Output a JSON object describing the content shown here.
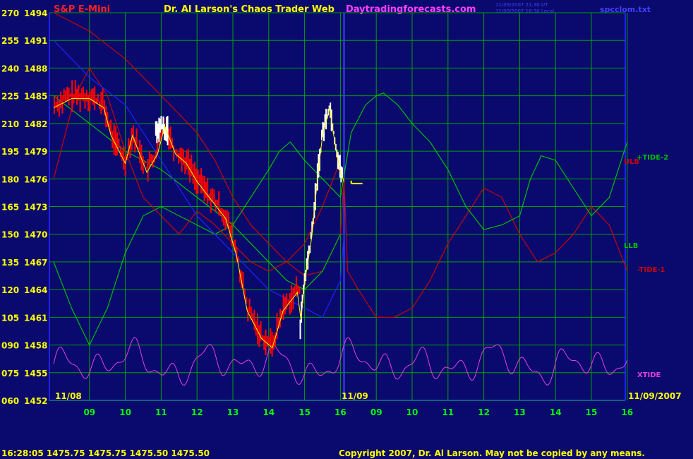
{
  "header": {
    "left_title": "S&P E-Mini",
    "main_title": "Dr. Al Larson's Chaos Trader Web",
    "site": "Daytradingforecasts.com",
    "stamp_line1": "11/09/2007 21:30 UT",
    "stamp_line2": "11/09/2007 16:30 Local",
    "file": "spcclom.txt"
  },
  "footer": {
    "quote": "16:28:05  1475.75 1475.75 1475.50 1475.50",
    "copyright": "Copyright 2007, Dr. Al Larson. May not be copied by any means."
  },
  "date_labels": {
    "left": "11/08",
    "mid": "11/09",
    "right": "11/09/2007"
  },
  "colors": {
    "background": "#0a0a6e",
    "grid": "#00a000",
    "price_bars": "#ff0000",
    "white_bars": "#ffffff",
    "yellow_avg": "#ffff00",
    "tide2": "#00c000",
    "ulb": "#cc0000",
    "llb": "#00c000",
    "tide1": "#cc0000",
    "xtide": "#e040e0",
    "blue_line": "#2020ff",
    "site_text": "#ff40ff",
    "title_text": "#ffff00",
    "left_title_text": "#ff2020",
    "axis_text": "#ffff00",
    "date_text": "#ffff00",
    "hour_text": "#00ff00"
  },
  "chart_data": {
    "type": "line",
    "title": "S&P E-Mini",
    "left_axis_ticks": [
      "270",
      "255",
      "240",
      "225",
      "210",
      "195",
      "180",
      "165",
      "150",
      "135",
      "120",
      "105",
      "090",
      "075",
      "060"
    ],
    "price_axis_ticks": [
      "1494",
      "1491",
      "1488",
      "1485",
      "1482",
      "1479",
      "1476",
      "1473",
      "1470",
      "1467",
      "1464",
      "1461",
      "1458",
      "1455",
      "1452"
    ],
    "ylim": [
      1452,
      1494
    ],
    "x_hour_labels": [
      "09",
      "10",
      "11",
      "12",
      "13",
      "14",
      "15",
      "16",
      "09",
      "10",
      "11",
      "12",
      "13",
      "14",
      "15",
      "16"
    ],
    "last_price": 1475.5,
    "series": [
      {
        "name": "+TIDE-2",
        "label": "+TIDE-2"
      },
      {
        "name": "ULB",
        "label": "ULB"
      },
      {
        "name": "LLB",
        "label": "LLB"
      },
      {
        "name": "-TIDE-1",
        "label": "-TIDE-1"
      },
      {
        "name": "XTIDE",
        "label": "XTIDE"
      }
    ],
    "tide2_points": [
      [
        0,
        1467
      ],
      [
        0.5,
        1462
      ],
      [
        1,
        1458
      ],
      [
        1.5,
        1462
      ],
      [
        2,
        1468
      ],
      [
        2.5,
        1472
      ],
      [
        3,
        1473
      ],
      [
        3.5,
        1472
      ],
      [
        4,
        1471
      ],
      [
        4.5,
        1470
      ],
      [
        5,
        1471
      ],
      [
        5.5,
        1474
      ],
      [
        6,
        1477
      ],
      [
        6.3,
        1479
      ],
      [
        6.6,
        1480
      ],
      [
        7,
        1478
      ],
      [
        7.5,
        1476
      ],
      [
        8,
        1474
      ],
      [
        8.3,
        1481
      ],
      [
        8.7,
        1484
      ],
      [
        9,
        1485
      ],
      [
        9.2,
        1485.3
      ],
      [
        9.6,
        1484
      ],
      [
        10,
        1482
      ],
      [
        10.5,
        1480
      ],
      [
        11,
        1477
      ],
      [
        11.5,
        1473
      ],
      [
        12,
        1470.5
      ],
      [
        12.5,
        1471
      ],
      [
        13,
        1472
      ],
      [
        13.3,
        1476
      ],
      [
        13.6,
        1478.5
      ],
      [
        14,
        1478
      ],
      [
        14.5,
        1475
      ],
      [
        15,
        1472
      ],
      [
        15.5,
        1474
      ],
      [
        16,
        1480
      ]
    ],
    "ulb_points": [
      [
        0,
        1494
      ],
      [
        1,
        1492
      ],
      [
        2,
        1489
      ],
      [
        3,
        1485
      ],
      [
        4,
        1481
      ],
      [
        4.5,
        1478
      ],
      [
        5,
        1474
      ],
      [
        5.5,
        1471
      ],
      [
        6,
        1469
      ],
      [
        6.5,
        1467
      ],
      [
        7,
        1465.5
      ],
      [
        7.5,
        1466
      ],
      [
        8,
        1470
      ],
      [
        8.1,
        1476
      ],
      [
        8.2,
        1466
      ],
      [
        8.5,
        1464
      ],
      [
        9,
        1461
      ],
      [
        9.5,
        1461
      ],
      [
        10,
        1462
      ],
      [
        10.5,
        1465
      ],
      [
        11,
        1469
      ],
      [
        11.5,
        1472
      ],
      [
        12,
        1475
      ],
      [
        12.5,
        1474
      ],
      [
        13,
        1470
      ],
      [
        13.5,
        1467
      ],
      [
        14,
        1468
      ],
      [
        14.5,
        1470
      ],
      [
        15,
        1473
      ],
      [
        15.5,
        1471
      ],
      [
        16,
        1466
      ]
    ]
  }
}
